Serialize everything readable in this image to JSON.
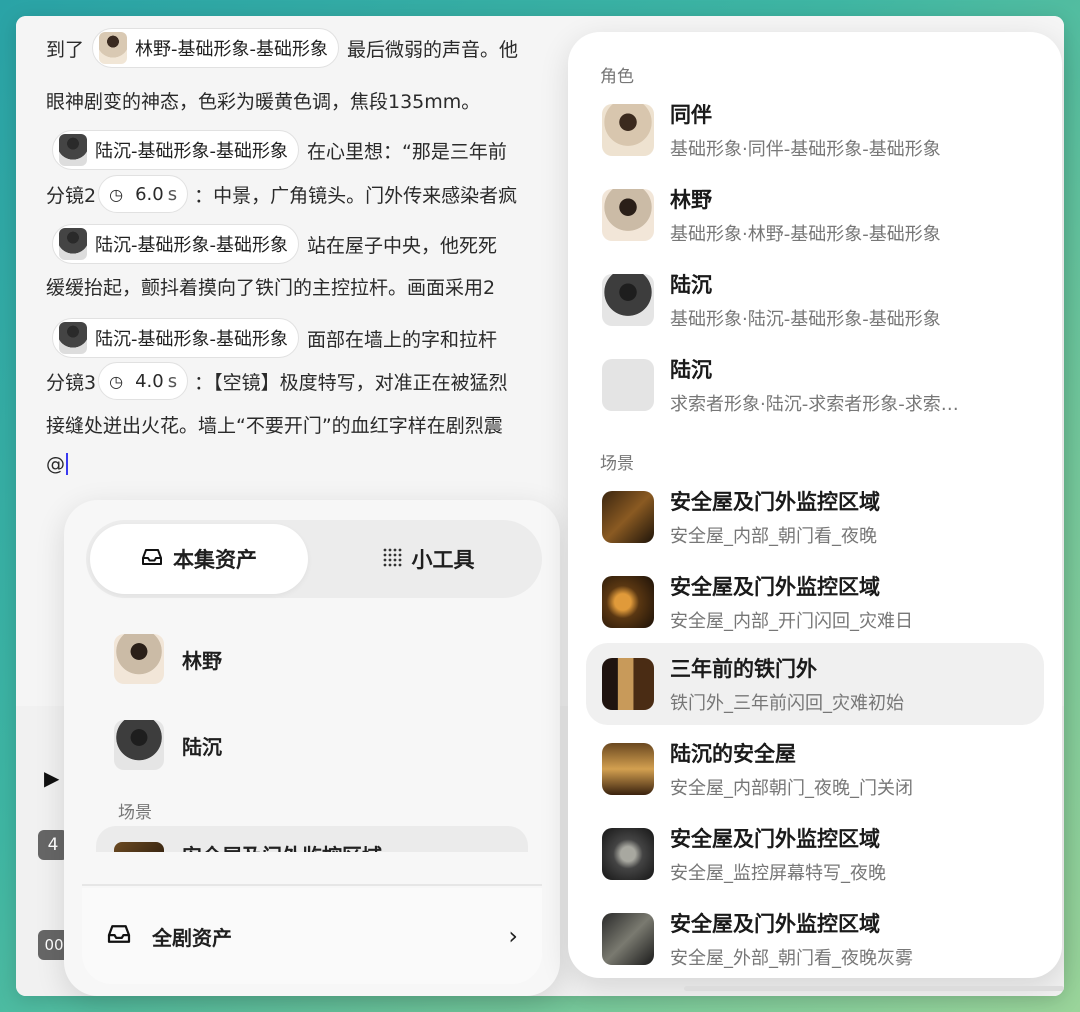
{
  "editor": {
    "l1": {
      "pre": "到了",
      "chip": "林野-基础形象-基础形象",
      "post": "最后微弱的声音。他"
    },
    "l2": {
      "text": "眼神剧变的神态，色彩为暖黄色调，焦段135mm。"
    },
    "l3": {
      "chip": "陆沉-基础形象-基础形象",
      "post": "在心里想：“那是三年前"
    },
    "l4": {
      "pre": "分镜2",
      "duration": "6.0",
      "unit": "s",
      "post": "：中景，广角镜头。门外传来感染者疯"
    },
    "l5": {
      "chip": "陆沉-基础形象-基础形象",
      "post": "站在屋子中央，他死死"
    },
    "l6": {
      "text": "缓缓抬起，颤抖着摸向了铁门的主控拉杆。画面采用2"
    },
    "l7": {
      "chip": "陆沉-基础形象-基础形象",
      "post": "面部在墙上的字和拉杆"
    },
    "l8": {
      "pre": "分镜3",
      "duration": "4.0",
      "unit": "s",
      "post": "：【空镜】极度特写，对准正在被猛烈"
    },
    "l9": {
      "text": "接缝处迸出火花。墙上“不要开门”的血红字样在剧烈震"
    },
    "l10": {
      "text": "@"
    }
  },
  "bottom": {
    "badge1": "4",
    "badge2": "00"
  },
  "left_panel": {
    "tabs": [
      {
        "label": "本集资产",
        "icon": "inbox-icon"
      },
      {
        "label": "小工具",
        "icon": "grid-dots-icon"
      }
    ],
    "items": [
      {
        "label": "林野"
      },
      {
        "label": "陆沉"
      }
    ],
    "section_scene": "场景",
    "cut_item": "安全屋及门外监控区域",
    "footer": {
      "label": "全剧资产",
      "icon": "inbox-icon"
    }
  },
  "right_panel": {
    "section_role": "角色",
    "roles": [
      {
        "title": "同伴",
        "sub": "基础形象·同伴-基础形象-基础形象"
      },
      {
        "title": "林野",
        "sub": "基础形象·林野-基础形象-基础形象"
      },
      {
        "title": "陆沉",
        "sub": "基础形象·陆沉-基础形象-基础形象"
      },
      {
        "title": "陆沉",
        "sub": "求索者形象·陆沉-求索者形象-求索…"
      }
    ],
    "section_scene": "场景",
    "scenes": [
      {
        "title": "安全屋及门外监控区域",
        "sub": "安全屋_内部_朝门看_夜晚"
      },
      {
        "title": "安全屋及门外监控区域",
        "sub": "安全屋_内部_开门闪回_灾难日"
      },
      {
        "title": "三年前的铁门外",
        "sub": "铁门外_三年前闪回_灾难初始"
      },
      {
        "title": "陆沉的安全屋",
        "sub": "安全屋_内部朝门_夜晚_门关闭"
      },
      {
        "title": "安全屋及门外监控区域",
        "sub": "安全屋_监控屏幕特写_夜晚"
      },
      {
        "title": "安全屋及门外监控区域",
        "sub": "安全屋_外部_朝门看_夜晚灰雾"
      }
    ],
    "selected_scene_index": 2
  }
}
